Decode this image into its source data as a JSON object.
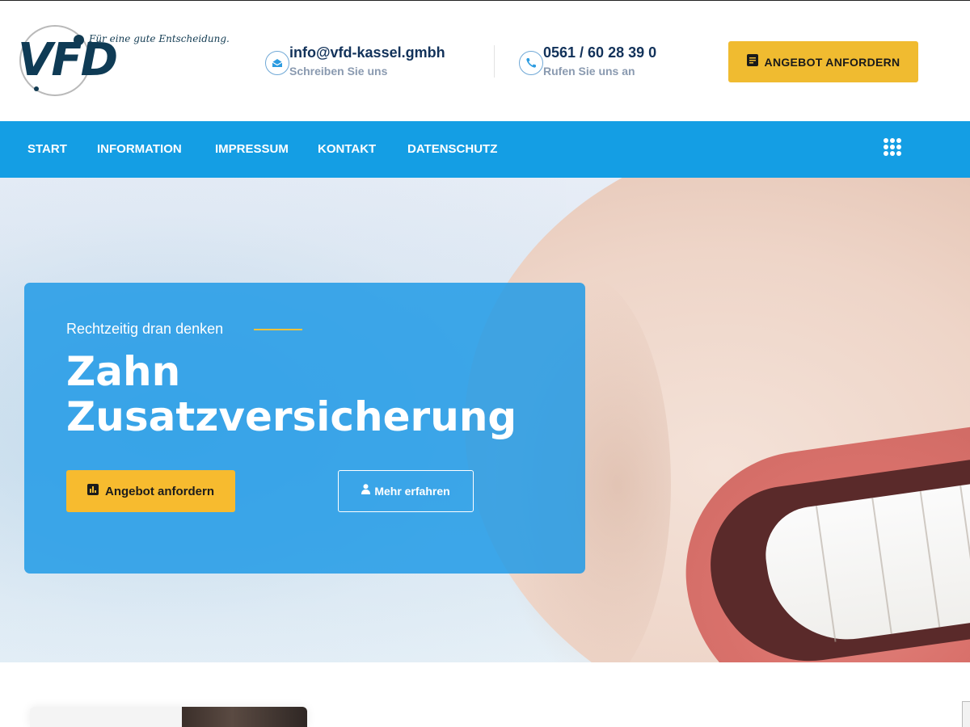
{
  "brand": {
    "logo_text": "VFD",
    "tagline": "Für eine gute Entscheidung."
  },
  "header": {
    "email": {
      "title": "info@vfd-kassel.gmbh",
      "subtitle": "Schreiben Sie uns",
      "icon": "envelope-icon"
    },
    "phone": {
      "title": "0561 / 60 28 39 0",
      "subtitle": "Rufen Sie uns an",
      "icon": "phone-icon"
    },
    "cta_label": "ANGEBOT ANFORDERN",
    "cta_icon": "document-icon"
  },
  "nav": {
    "items": [
      "START",
      "INFORMATION",
      "IMPRESSUM",
      "KONTAKT",
      "DATENSCHUTZ"
    ],
    "menu_icon": "grid-menu-icon"
  },
  "hero": {
    "eyebrow": "Rechtzeitig dran denken",
    "title_line1": "Zahn",
    "title_line2": "Zusatzversicherung",
    "primary_label": "Angebot anfordern",
    "primary_icon": "chart-icon",
    "secondary_label": "Mehr erfahren",
    "secondary_icon": "user-icon"
  },
  "colors": {
    "nav_blue": "#149ee4",
    "accent_yellow": "#f0bb30",
    "navy": "#12325a",
    "hero_panel": "#209ae6"
  }
}
